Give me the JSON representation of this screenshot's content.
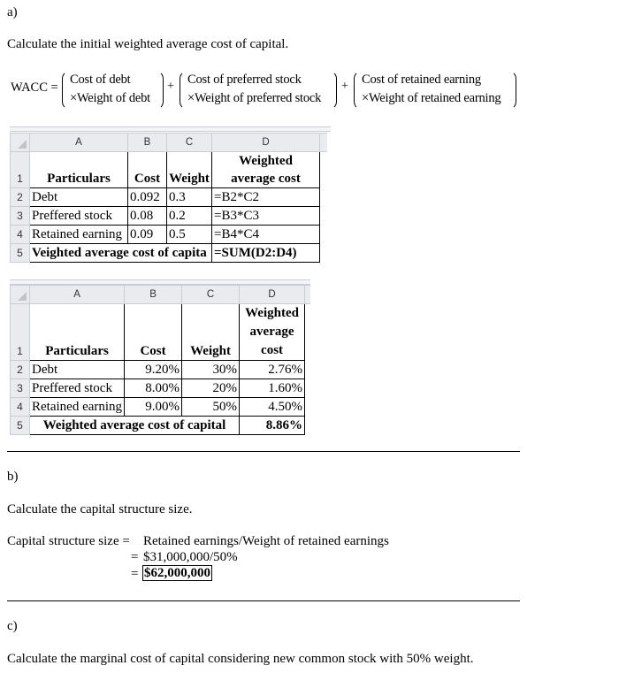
{
  "part_a": {
    "label": "a)",
    "instruction": "Calculate the initial weighted average cost of capital.",
    "formula": {
      "lhs": "WACC =",
      "plus": "+",
      "terms": [
        {
          "line1": "Cost of debt",
          "line2": "×Weight of debt"
        },
        {
          "line1": "Cost of preferred stock",
          "line2": "×Weight of preferred stock"
        },
        {
          "line1": "Cost of retained earning",
          "line2": "×Weight of retained earning"
        }
      ]
    },
    "formula_sheet": {
      "columns": [
        "A",
        "B",
        "C",
        "D"
      ],
      "row_numbers": [
        "1",
        "2",
        "3",
        "4",
        "5"
      ],
      "header": {
        "particulars": "Particulars",
        "cost": "Cost",
        "weight": "Weight",
        "wac_line1": "Weighted",
        "wac_line2": "average cost"
      },
      "rows": [
        {
          "particular": "Debt",
          "cost": "0.092",
          "weight": "0.3",
          "wac": "=B2*C2"
        },
        {
          "particular": "Preffered stock",
          "cost": "0.08",
          "weight": "0.2",
          "wac": "=B3*C3"
        },
        {
          "particular": "Retained earning",
          "cost": "0.09",
          "weight": "0.5",
          "wac": "=B4*C4"
        }
      ],
      "total": {
        "label": "Veighted average cost of capita",
        "value": "=SUM(D2:D4)"
      }
    },
    "value_sheet": {
      "columns": [
        "A",
        "B",
        "C",
        "D"
      ],
      "row_numbers": [
        "1",
        "2",
        "3",
        "4",
        "5"
      ],
      "header": {
        "particulars": "Particulars",
        "cost": "Cost",
        "weight": "Weight",
        "wac_line1": "Weighted",
        "wac_line2": "average",
        "wac_line3": "cost"
      },
      "rows": [
        {
          "particular": "Debt",
          "cost": "9.20%",
          "weight": "30%",
          "wac": "2.76%"
        },
        {
          "particular": "Preffered stock",
          "cost": "8.00%",
          "weight": "20%",
          "wac": "1.60%"
        },
        {
          "particular": "Retained earning",
          "cost": "9.00%",
          "weight": "50%",
          "wac": "4.50%"
        }
      ],
      "total": {
        "label": "Weighted average cost of capital",
        "value": "8.86%"
      }
    }
  },
  "part_b": {
    "label": "b)",
    "instruction": "Calculate the capital structure size.",
    "lines": [
      {
        "lhs": "Capital structure size =",
        "rhs": "Retained earnings/Weight of retained earnings"
      },
      {
        "lhs": "=",
        "rhs": "$31,000,000/50%"
      },
      {
        "lhs": "=",
        "rhs": "$62,000,000"
      }
    ]
  },
  "part_c": {
    "label": "c)",
    "instruction": "Calculate the marginal cost of capital considering new common stock with 50% weight."
  }
}
